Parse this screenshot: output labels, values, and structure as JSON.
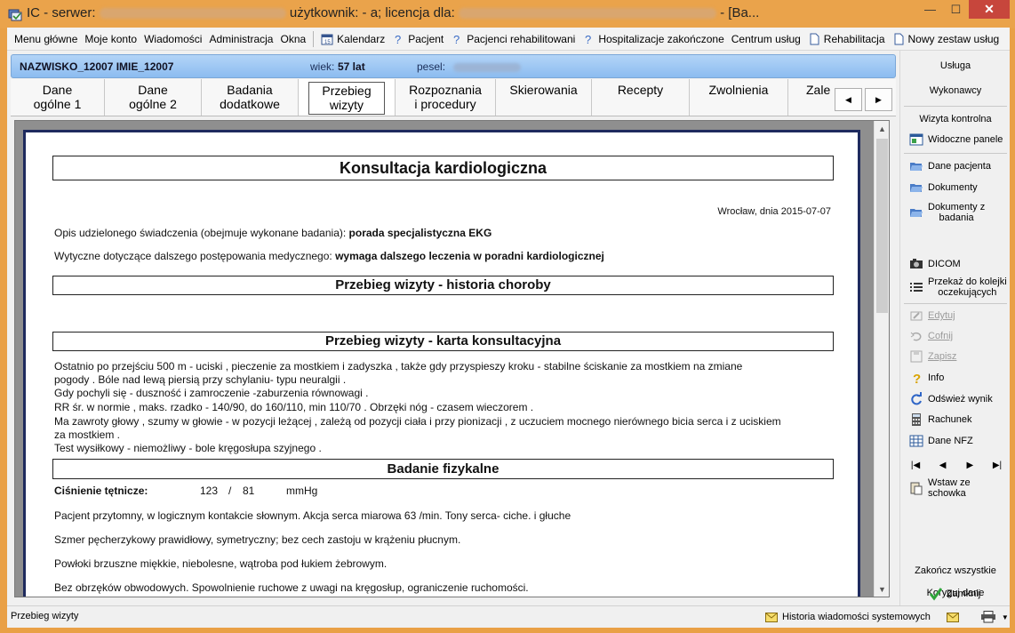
{
  "window": {
    "title_prefix": "IC - serwer:",
    "title_user": "użytkownik: - a; licencja dla:",
    "title_suffix": "- [Ba...",
    "minimize": "—",
    "maximize": "☐",
    "close": "✕"
  },
  "menu": {
    "items": [
      "Menu główne",
      "Moje konto",
      "Wiadomości",
      "Administracja",
      "Okna"
    ],
    "toolbar": [
      {
        "label": "Kalendarz",
        "icon": "calendar-icon"
      },
      {
        "label": "Pacjent",
        "icon": "help-icon"
      },
      {
        "label": "Pacjenci rehabilitowani",
        "icon": "help-icon"
      },
      {
        "label": "Hospitalizacje zakończone",
        "icon": "help-icon"
      },
      {
        "label": "Centrum usług",
        "icon": ""
      },
      {
        "label": "Rehabilitacja",
        "icon": "document-icon"
      },
      {
        "label": "Nowy zestaw usług",
        "icon": "document-icon"
      }
    ]
  },
  "patient": {
    "name": "NAZWISKO_12007 IMIE_12007",
    "age_label": "wiek:",
    "age_value": "57 lat",
    "pesel_label": "pesel:"
  },
  "tabs": [
    {
      "line1": "Dane",
      "line2": "ogólne 1"
    },
    {
      "line1": "Dane",
      "line2": "ogólne 2"
    },
    {
      "line1": "Badania",
      "line2": "dodatkowe"
    },
    {
      "line1": "Przebieg",
      "line2": "wizyty",
      "active": true
    },
    {
      "line1": "Rozpoznania",
      "line2": "i procedury"
    },
    {
      "line1": "Skierowania",
      "line2": ""
    },
    {
      "line1": "Recepty",
      "line2": ""
    },
    {
      "line1": "Zwolnienia",
      "line2": ""
    },
    {
      "line1": "Zale",
      "line2": ""
    }
  ],
  "tab_scroll": {
    "left": "◀",
    "right": "▶"
  },
  "doc": {
    "title": "Konsultacja kardiologiczna",
    "place_date": "Wrocław, dnia 2015-07-07",
    "service_label": "Opis udzielonego świadczenia (obejmuje wykonane badania):",
    "service_value": "porada specjalistyczna EKG",
    "guidelines_label": "Wytyczne dotyczące dalszego postępowania medycznego:",
    "guidelines_value": "wymaga dalszego leczenia w poradni kardiologicznej",
    "section_history": "Przebieg wizyty - historia choroby",
    "section_card": "Przebieg wizyty - karta konsultacyjna",
    "card_lines": [
      "Ostatnio  po przejściu 500 m   - uciski , pieczenie za mostkiem i zadyszka  , także  gdy przyspieszy kroku - stabilne ściskanie za mostkiem na zmiane",
      "pogody . Bóle nad lewą piersią przy schylaniu- typu neuralgii  .",
      "Gdy pochyli się - duszność  i zamroczenie -zaburzenia równowagi  .",
      "RR  śr. w normie , maks. rzadko  - 140/90, do 160/110, min 110/70      .  Obrzęki nóg - czasem wieczorem  .",
      "Ma zawroty głowy , szumy w głowie - w pozycji leżącej , zależą od pozycji ciała i  przy pionizacji , z uczuciem mocnego nierównego bicia serca i z uciskiem",
      "za mostkiem .",
      "Test wysiłkowy - niemożliwy - bole kręgosłupa szyjnego ."
    ],
    "section_exam": "Badanie fizykalne",
    "bp_label": "Ciśnienie tętnicze:",
    "bp_sys": "123",
    "bp_sep": "/",
    "bp_dia": "81",
    "bp_unit": "mmHg",
    "exam_lines": [
      "Pacjent przytomny, w logicznym kontakcie słownym.  Akcja serca miarowa  63  /min. Tony serca- ciche. i głuche",
      "Szmer pęcherzykowy prawidłowy, symetryczny; bez cech zastoju w krążeniu płucnym.",
      "Powłoki brzuszne miękkie, niebolesne, wątroba pod łukiem żebrowym.",
      "Bez obrzęków obwodowych.  Spowolnienie ruchowe z uwagi na kręgosłup, ograniczenie ruchomości."
    ]
  },
  "right_panel": {
    "usluga": "Usługa",
    "wykonawcy": "Wykonawcy",
    "wizyta_kontrolna": "Wizyta kontrolna",
    "widoczne_panele": "Widoczne panele",
    "dane_pacjenta": "Dane pacjenta",
    "dokumenty": "Dokumenty",
    "dokumenty_z_badania_1": "Dokumenty z",
    "dokumenty_z_badania_2": "badania",
    "dicom": "DICOM",
    "przekaz_1": "Przekaż do kolejki",
    "przekaz_2": "oczekujących",
    "edytuj": "Edytuj",
    "cofnij": "Cofnij",
    "zapisz": "Zapisz",
    "info": "Info",
    "odswiez": "Odśwież wynik",
    "rachunek": "Rachunek",
    "dane_nfz": "Dane NFZ",
    "wstaw": "Wstaw ze schowka",
    "zakoncz": "Zakończ wszystkie",
    "koryguj": "Koryguj dane",
    "zamknij": "Zamknij"
  },
  "status": {
    "left": "Przebieg wizyty",
    "messages": "Historia wiadomości systemowych"
  }
}
